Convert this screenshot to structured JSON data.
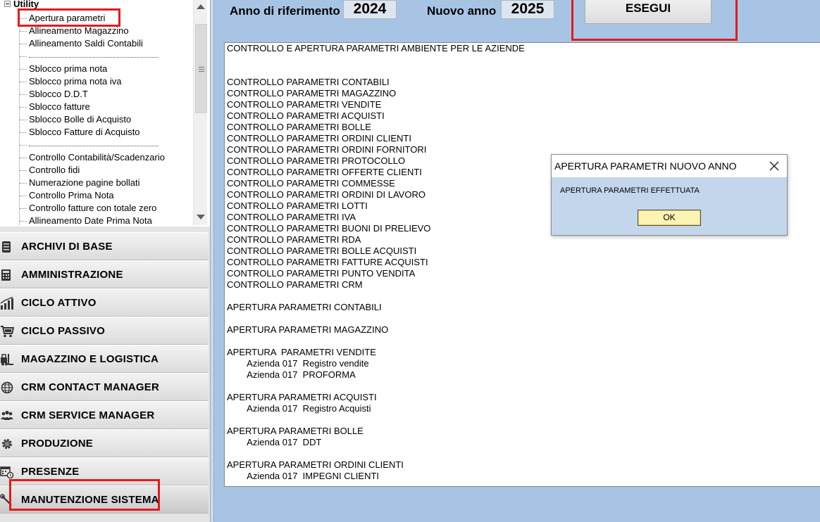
{
  "tree": {
    "root_label": "Utility",
    "items": [
      "Apertura parametri",
      "Allineamento Magazzino",
      "Allineamento Saldi Contabili",
      "",
      "Sblocco prima nota",
      "Sblocco prima nota iva",
      "Sblocco D.D.T",
      "Sblocco fatture",
      "Sblocco Bolle di Acquisto",
      "Sblocco Fatture di Acquisto",
      "",
      "Controllo Contabilità/Scadenzario",
      "Controllo fidi",
      "Numerazione pagine bollati",
      "Controllo Prima Nota",
      "Controllo fatture con totale zero",
      "Allineamento Date Prima Nota"
    ]
  },
  "menu": {
    "items": [
      {
        "label": "ARCHIVI DI BASE",
        "icon": "database-icon"
      },
      {
        "label": "AMMINISTRAZIONE",
        "icon": "calculator-icon"
      },
      {
        "label": "CICLO ATTIVO",
        "icon": "chart-icon"
      },
      {
        "label": "CICLO PASSIVO",
        "icon": "cart-icon"
      },
      {
        "label": "MAGAZZINO E LOGISTICA",
        "icon": "forklift-icon"
      },
      {
        "label": "CRM CONTACT MANAGER",
        "icon": "globe-icon"
      },
      {
        "label": "CRM SERVICE MANAGER",
        "icon": "people-icon"
      },
      {
        "label": "PRODUZIONE",
        "icon": "gear-icon"
      },
      {
        "label": "PRESENZE",
        "icon": "calendar-clock-icon"
      },
      {
        "label": "MANUTENZIONE SISTEMA",
        "icon": "wrench-icon"
      }
    ]
  },
  "toolbar": {
    "anno_riferimento_label": "Anno di riferimento",
    "anno_riferimento_value": "2024",
    "nuovo_anno_label": "Nuovo anno",
    "nuovo_anno_value": "2025",
    "esegui_label": "ESEGUI"
  },
  "log": [
    "CONTROLLO E APERTURA PARAMETRI AMBIENTE PER LE AZIENDE",
    "",
    "",
    "CONTROLLO PARAMETRI CONTABILI",
    "CONTROLLO PARAMETRI MAGAZZINO",
    "CONTROLLO PARAMETRI VENDITE",
    "CONTROLLO PARAMETRI ACQUISTI",
    "CONTROLLO PARAMETRI BOLLE",
    "CONTROLLO PARAMETRI ORDINI CLIENTI",
    "CONTROLLO PARAMETRI ORDINI FORNITORI",
    "CONTROLLO PARAMETRI PROTOCOLLO",
    "CONTROLLO PARAMETRI OFFERTE CLIENTI",
    "CONTROLLO PARAMETRI COMMESSE",
    "CONTROLLO PARAMETRI ORDINI DI LAVORO",
    "CONTROLLO PARAMETRI LOTTI",
    "CONTROLLO PARAMETRI IVA",
    "CONTROLLO PARAMETRI BUONI DI PRELIEVO",
    "CONTROLLO PARAMETRI RDA",
    "CONTROLLO PARAMETRI BOLLE ACQUISTI",
    "CONTROLLO PARAMETRI FATTURE ACQUISTI",
    "CONTROLLO PARAMETRI PUNTO VENDITA",
    "CONTROLLO PARAMETRI CRM",
    "",
    "APERTURA PARAMETRI CONTABILI",
    "",
    "APERTURA PARAMETRI MAGAZZINO",
    "",
    "APERTURA  PARAMETRI VENDITE",
    "        Azienda 017  Registro vendite",
    "        Azienda 017  PROFORMA",
    "",
    "APERTURA PARAMETRI ACQUISTI",
    "        Azienda 017  Registro Acquisti",
    "",
    "APERTURA PARAMETRI BOLLE",
    "        Azienda 017  DDT",
    "",
    "APERTURA PARAMETRI ORDINI CLIENTI",
    "        Azienda 017  IMPEGNI CLIENTI"
  ],
  "dialog": {
    "title": "APERTURA PARAMETRI NUOVO ANNO",
    "message": "APERTURA PARAMETRI EFFETTUATA",
    "ok_label": "OK"
  },
  "colors": {
    "highlight": "#e21b1b",
    "panel_bg": "#a8c4e4",
    "dialog_bg": "#c4d6ec",
    "ok_button_bg": "#fdf3b3"
  }
}
